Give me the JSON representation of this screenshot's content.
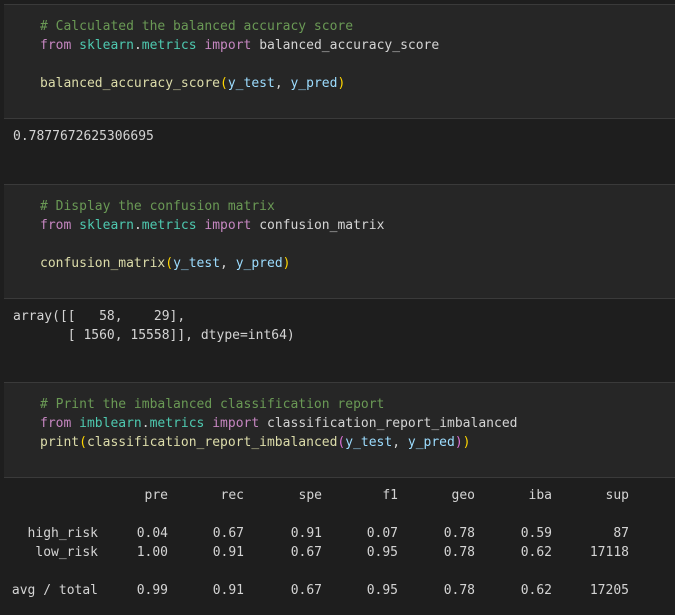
{
  "cell1": {
    "comment": "# Calculated the balanced accuracy score",
    "import_from": "from",
    "import_module": "sklearn",
    "import_dot": ".",
    "import_sub": "metrics",
    "import_kw": "import",
    "import_name": "balanced_accuracy_score",
    "call_fn": "balanced_accuracy_score",
    "call_open": "(",
    "call_arg1": "y_test",
    "call_sep": ", ",
    "call_arg2": "y_pred",
    "call_close": ")"
  },
  "output1": "0.7877672625306695",
  "cell2": {
    "comment": "# Display the confusion matrix",
    "import_from": "from",
    "import_module": "sklearn",
    "import_dot": ".",
    "import_sub": "metrics",
    "import_kw": "import",
    "import_name": "confusion_matrix",
    "call_fn": "confusion_matrix",
    "call_open": "(",
    "call_arg1": "y_test",
    "call_sep": ", ",
    "call_arg2": "y_pred",
    "call_close": ")"
  },
  "output2": {
    "line1": "array([[   58,    29],",
    "line2": "       [ 1560, 15558]], dtype=int64)"
  },
  "cell3": {
    "comment": "# Print the imbalanced classification report",
    "import_from": "from",
    "import_module": "imblearn",
    "import_dot": ".",
    "import_sub": "metrics",
    "import_kw": "import",
    "import_name": "classification_report_imbalanced",
    "print_fn": "print",
    "print_open": "(",
    "call_fn": "classification_report_imbalanced",
    "call_open": "(",
    "call_arg1": "y_test",
    "call_sep": ", ",
    "call_arg2": "y_pred",
    "call_close": ")",
    "print_close": ")"
  },
  "report": {
    "headers": [
      "pre",
      "rec",
      "spe",
      "f1",
      "geo",
      "iba",
      "sup"
    ],
    "rows": [
      {
        "label": "high_risk",
        "values": [
          "0.04",
          "0.67",
          "0.91",
          "0.07",
          "0.78",
          "0.59",
          "87"
        ]
      },
      {
        "label": "low_risk",
        "values": [
          "1.00",
          "0.91",
          "0.67",
          "0.95",
          "0.78",
          "0.62",
          "17118"
        ]
      },
      {
        "label": "avg / total",
        "values": [
          "0.99",
          "0.91",
          "0.67",
          "0.95",
          "0.78",
          "0.62",
          "17205"
        ]
      }
    ]
  },
  "colors": {
    "background": "#1e1e1e",
    "cell_background": "#262626",
    "comment": "#6a9955",
    "keyword": "#c586c0",
    "module": "#4ec9b0",
    "function": "#dcdcaa",
    "variable": "#9cdcfe",
    "bracket": "#ffd700"
  }
}
